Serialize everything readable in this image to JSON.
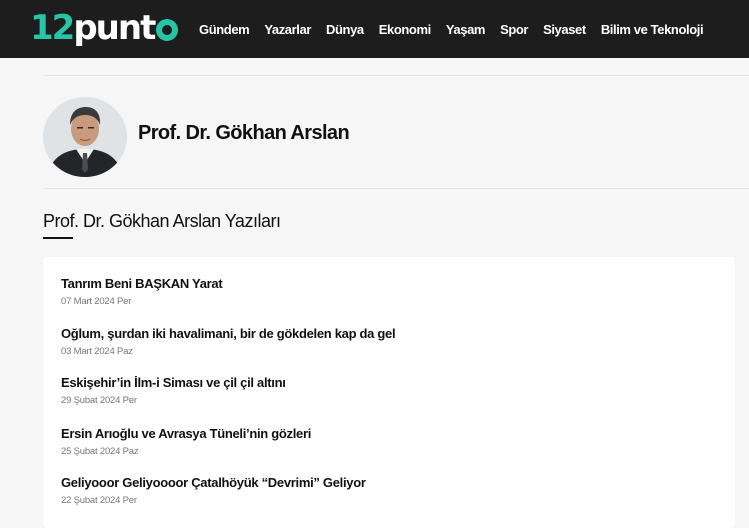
{
  "site": {
    "logo_number": "12",
    "logo_word": "punt",
    "nav": [
      "Gündem",
      "Yazarlar",
      "Dünya",
      "Ekonomi",
      "Yaşam",
      "Spor",
      "Siyaset",
      "Bilim ve Teknoloji"
    ]
  },
  "author": {
    "name": "Prof. Dr. Gökhan Arslan"
  },
  "section": {
    "title": "Prof. Dr. Gökhan Arslan Yazıları"
  },
  "articles": [
    {
      "title": "Tanrım Beni BAŞKAN Yarat",
      "date": "07 Mart 2024 Per"
    },
    {
      "title": "Oğlum, şurdan iki havalimani, bir de gökdelen kap da gel",
      "date": "03 Mart 2024 Paz"
    },
    {
      "title": "Eskişehir’in İlm-i Siması ve çil çil altını",
      "date": "29 Şubat 2024 Per"
    },
    {
      "title": "Ersin Arıoğlu ve Avrasya Tüneli’nin gözleri",
      "date": "25 Şubat 2024 Paz"
    },
    {
      "title": "Geliyooor Geliyoooor Çatalhöyük “Devrimi” Geliyor",
      "date": "22 Şubat 2024 Per"
    }
  ]
}
